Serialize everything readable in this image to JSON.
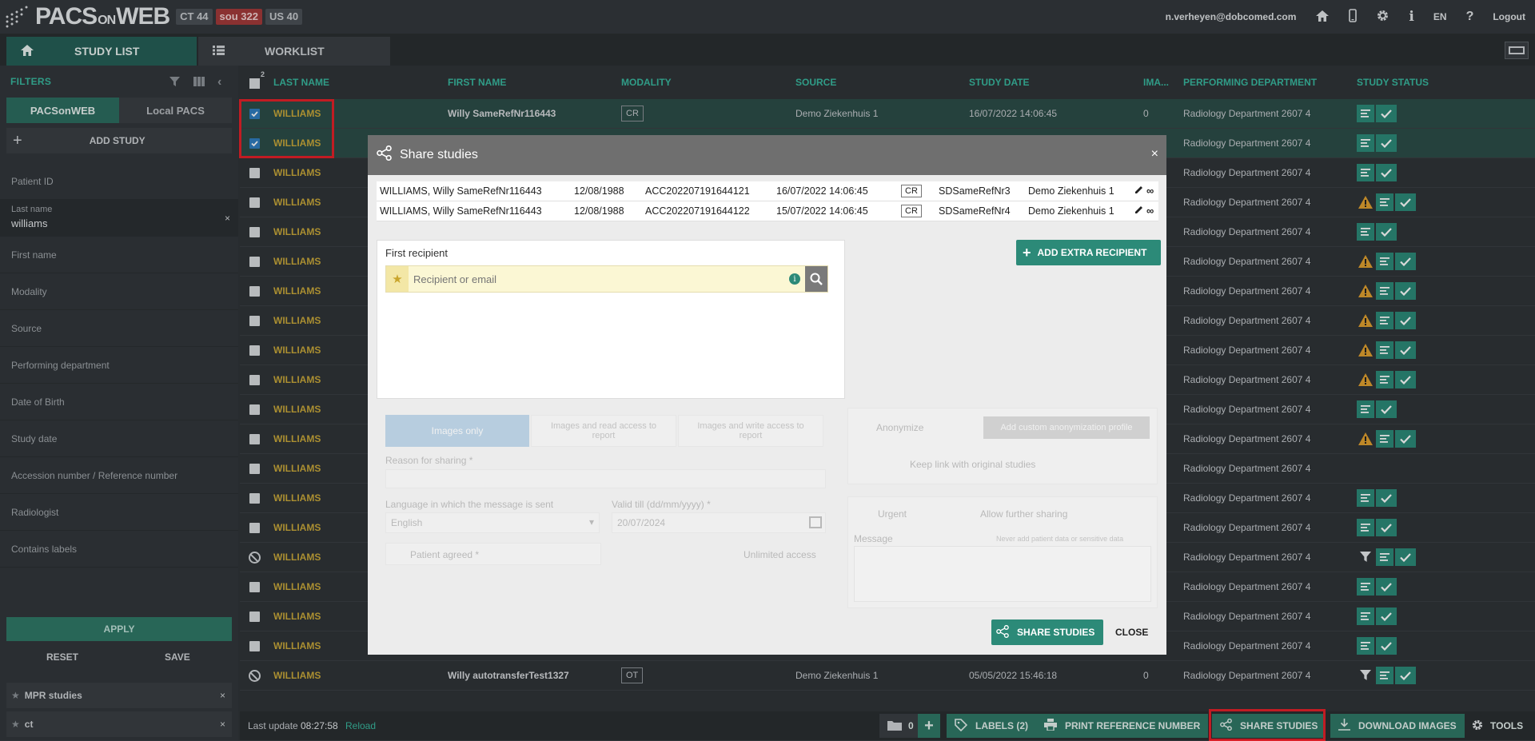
{
  "header": {
    "logo": "PACSONWEB",
    "badges": [
      {
        "label": "CT 44"
      },
      {
        "label": "sou 322"
      },
      {
        "label": "US 40"
      }
    ],
    "user_email": "n.verheyen@dobcomed.com",
    "language": "EN",
    "logout": "Logout"
  },
  "tabs": {
    "study_list": "STUDY LIST",
    "worklist": "WORKLIST"
  },
  "filters": {
    "title": "FILTERS",
    "source_tabs": [
      "PACSonWEB",
      "Local PACS"
    ],
    "add_study": "ADD STUDY",
    "fields": [
      "Patient ID",
      "First name",
      "Modality",
      "Source",
      "Performing department",
      "Date of Birth",
      "Study date",
      "Accession number / Reference number",
      "Radiologist",
      "Contains labels"
    ],
    "last_name_label": "Last name",
    "last_name_value": "williams",
    "apply": "APPLY",
    "reset": "RESET",
    "save": "SAVE",
    "saved": [
      "MPR studies",
      "ct"
    ]
  },
  "table": {
    "selected_count": "2",
    "columns": [
      "LAST NAME",
      "FIRST NAME",
      "MODALITY",
      "SOURCE",
      "STUDY DATE",
      "IMA...",
      "PERFORMING DEPARTMENT",
      "STUDY STATUS"
    ],
    "rows": [
      {
        "last": "WILLIAMS",
        "first": "Willy SameRefNr116443",
        "mod": "CR",
        "src": "Demo Ziekenhuis 1",
        "date": "16/07/2022 14:06:45",
        "img": "0",
        "dept": "Radiology Department 2607 4",
        "status": "ok",
        "check": "on"
      },
      {
        "last": "WILLIAMS",
        "first": "",
        "mod": "",
        "src": "",
        "date": "",
        "img": "",
        "dept": "Radiology Department 2607 4",
        "status": "ok",
        "check": "on"
      },
      {
        "last": "WILLIAMS",
        "dept": "Radiology Department 2607 4",
        "status": "ok",
        "check": "off"
      },
      {
        "last": "WILLIAMS",
        "dept": "Radiology Department 2607 4",
        "status": "warn",
        "check": "off"
      },
      {
        "last": "WILLIAMS",
        "dept": "Radiology Department 2607 4",
        "status": "ok",
        "check": "off"
      },
      {
        "last": "WILLIAMS",
        "dept": "Radiology Department 2607 4",
        "status": "warn",
        "check": "off"
      },
      {
        "last": "WILLIAMS",
        "dept": "Radiology Department 2607 4",
        "status": "warn",
        "check": "off"
      },
      {
        "last": "WILLIAMS",
        "dept": "Radiology Department 2607 4",
        "status": "warn",
        "check": "off"
      },
      {
        "last": "WILLIAMS",
        "dept": "Radiology Department 2607 4",
        "status": "warn",
        "check": "off"
      },
      {
        "last": "WILLIAMS",
        "dept": "Radiology Department 2607 4",
        "status": "warn",
        "check": "off"
      },
      {
        "last": "WILLIAMS",
        "dept": "Radiology Department 2607 4",
        "status": "ok",
        "check": "off"
      },
      {
        "last": "WILLIAMS",
        "dept": "Radiology Department 2607 4",
        "status": "warn",
        "check": "off"
      },
      {
        "last": "WILLIAMS",
        "dept": "Radiology Department 2607 4",
        "status": "none",
        "check": "off"
      },
      {
        "last": "WILLIAMS",
        "dept": "Radiology Department 2607 4",
        "status": "ok",
        "check": "off"
      },
      {
        "last": "WILLIAMS",
        "dept": "Radiology Department 2607 4",
        "status": "ok",
        "check": "off"
      },
      {
        "last": "WILLIAMS",
        "dept": "Radiology Department 2607 4",
        "status": "filter",
        "check": "blocked"
      },
      {
        "last": "WILLIAMS",
        "dept": "Radiology Department 2607 4",
        "status": "ok",
        "check": "off"
      },
      {
        "last": "WILLIAMS",
        "dept": "Radiology Department 2607 4",
        "status": "ok",
        "check": "off"
      },
      {
        "last": "WILLIAMS",
        "dept": "Radiology Department 2607 4",
        "status": "ok",
        "check": "off"
      },
      {
        "last": "WILLIAMS",
        "first": "Willy autotransferTest1327",
        "mod": "OT",
        "src": "Demo Ziekenhuis 1",
        "date": "05/05/2022 15:46:18",
        "img": "0",
        "dept": "Radiology Department 2607 4",
        "status": "filter",
        "check": "blocked"
      }
    ]
  },
  "bottom": {
    "last_update_label": "Last update",
    "last_update_time": "08:27:58",
    "reload": "Reload",
    "folder_count": "0",
    "labels": "LABELS (2)",
    "print": "PRINT REFERENCE NUMBER",
    "share": "SHARE STUDIES",
    "download": "DOWNLOAD IMAGES",
    "tools": "TOOLS"
  },
  "modal": {
    "title": "Share studies",
    "close_x": "×",
    "studies": [
      {
        "name": "WILLIAMS, Willy SameRefNr116443",
        "dob": "12/08/1988",
        "acc": "ACC202207191644121",
        "date": "16/07/2022 14:06:45",
        "mod": "CR",
        "ref": "SDSameRefNr3",
        "src": "Demo Ziekenhuis 1"
      },
      {
        "name": "WILLIAMS, Willy SameRefNr116443",
        "dob": "12/08/1988",
        "acc": "ACC202207191644122",
        "date": "15/07/2022 14:06:45",
        "mod": "CR",
        "ref": "SDSameRefNr4",
        "src": "Demo Ziekenhuis 1"
      }
    ],
    "first_recipient": "First recipient",
    "recipient_placeholder": "Recipient or email",
    "add_extra": "ADD EXTRA RECIPIENT",
    "access_options": [
      "Images only",
      "Images and read access to report",
      "Images and write access to report"
    ],
    "anonymize": "Anonymize",
    "add_custom": "Add custom anonymization profile",
    "keep_link": "Keep link with original studies",
    "reason": "Reason for sharing *",
    "language_label": "Language in which the message is sent",
    "language_value": "English",
    "valid_label": "Valid till (dd/mm/yyyy) *",
    "valid_value": "20/07/2024",
    "urgent": "Urgent",
    "allow_further": "Allow further sharing",
    "message_label": "Message",
    "message_hint": "Never add patient data or sensitive data",
    "patient_agreed": "Patient agreed *",
    "unlimited": "Unlimited access",
    "share_btn": "SHARE STUDIES",
    "close_btn": "CLOSE"
  },
  "colors": {
    "accent": "#2f7867",
    "status_green": "#2c8a78",
    "warning": "#e0a030",
    "highlight": "#e3222a",
    "name_gold": "#c9a83a"
  }
}
